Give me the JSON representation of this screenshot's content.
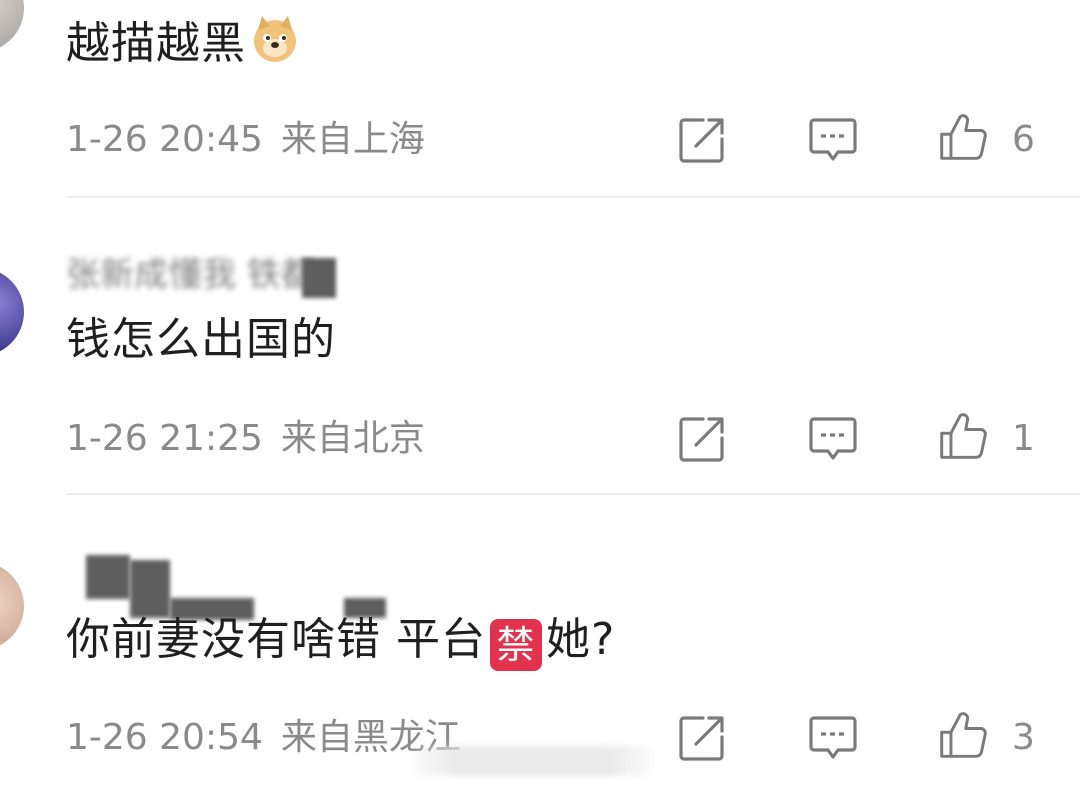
{
  "comments": [
    {
      "username": "",
      "text": "越描越黑",
      "emoji": "doge-icon",
      "time": "1-26 20:45",
      "location": "来自上海",
      "likes": "6"
    },
    {
      "username": "张新成懂我 铁都",
      "text": "钱怎么出国的",
      "time": "1-26 21:25",
      "location": "来自北京",
      "likes": "1"
    },
    {
      "username": "",
      "text_before": "你前妻没有啥错 平台",
      "ban_emoji": "禁",
      "text_after": "她?",
      "time": "1-26 20:54",
      "location": "来自黑龙江",
      "likes": "3"
    }
  ],
  "icons": {
    "share": "share-icon",
    "reply": "reply-icon",
    "like": "thumbs-up-icon"
  },
  "colors": {
    "text": "#1f1f1f",
    "meta": "#8a8a8a",
    "icon": "#7a7a7a",
    "divider": "#ececec",
    "ban_emoji_bg": "#e2334e"
  }
}
